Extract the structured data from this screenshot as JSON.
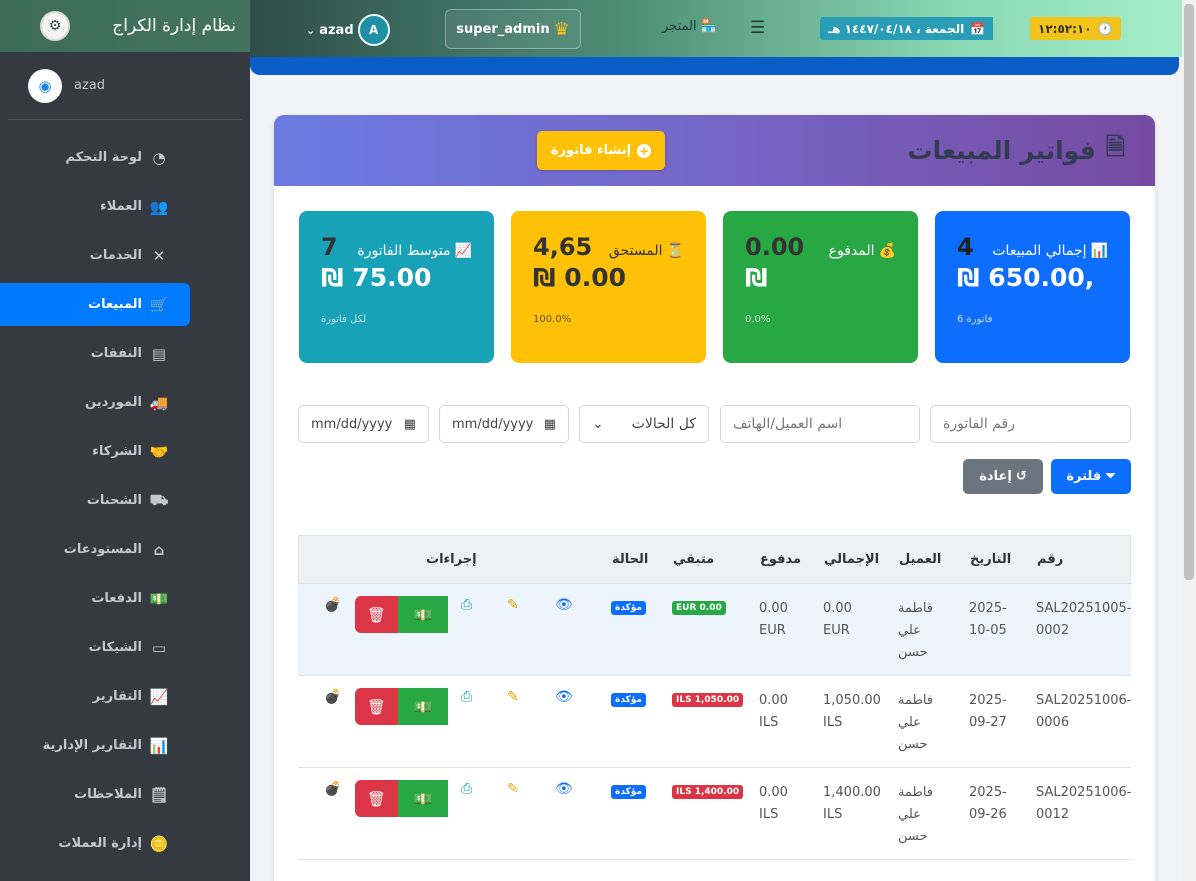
{
  "brand": {
    "title": "نظام إدارة الكراج"
  },
  "user_panel": {
    "name": "azad"
  },
  "sidebar": {
    "items": [
      {
        "label": "لوحة التحكم",
        "icon": "dashboard-icon"
      },
      {
        "label": "العملاء",
        "icon": "users-icon"
      },
      {
        "label": "الخدمات",
        "icon": "tools-icon"
      },
      {
        "label": "المبيعات",
        "icon": "cart-icon",
        "active": true
      },
      {
        "label": "النفقات",
        "icon": "receipt-icon"
      },
      {
        "label": "الموردين",
        "icon": "truck-icon"
      },
      {
        "label": "الشركاء",
        "icon": "handshake-icon"
      },
      {
        "label": "الشحنات",
        "icon": "shipping-icon"
      },
      {
        "label": "المستودعات",
        "icon": "warehouse-icon"
      },
      {
        "label": "الدفعات",
        "icon": "money-icon"
      },
      {
        "label": "الشيكات",
        "icon": "check-icon"
      },
      {
        "label": "التقارير",
        "icon": "chart-line-icon"
      },
      {
        "label": "التقارير الإدارية",
        "icon": "chart-bar-icon"
      },
      {
        "label": "الملاحظات",
        "icon": "note-icon"
      },
      {
        "label": "إدارة العملات",
        "icon": "coins-icon"
      }
    ]
  },
  "topbar": {
    "user": "azad",
    "avatar_letter": "A",
    "role": "super_admin",
    "store": "المتجر",
    "date": "الجمعة ، ١٤٤٧/٠٤/١٨ هـ",
    "time": "١٢:٥٢:١٠"
  },
  "header": {
    "title": "فواتير المبيعات",
    "create_button": "إنشاء فاتورة"
  },
  "stats": [
    {
      "number": "4",
      "label": "إجمالي المبيعات",
      "emoji": "📊",
      "value": "₪ 650.00,",
      "sub": "6 فاتورة"
    },
    {
      "number": "0.00",
      "label": "المدفوع",
      "emoji": "💰",
      "value": "₪",
      "sub": "0.0%"
    },
    {
      "number": "4,65",
      "label": "المستحق",
      "emoji": "⏳",
      "value": "₪ 0.00",
      "sub": "100.0%"
    },
    {
      "number": "7",
      "label": "متوسط الفاتورة",
      "emoji": "📈",
      "value": "₪ 75.00",
      "sub": "لكل فاتورة"
    }
  ],
  "filters": {
    "invoice_placeholder": "رقم الفاتورة",
    "customer_placeholder": "اسم العميل/الهاتف",
    "status_selected": "كل الحالات",
    "date_from": "mm/dd/yyyy",
    "date_to": "mm/dd/yyyy",
    "filter_button": "فلترة",
    "reset_button": "إعادة"
  },
  "table": {
    "headers": {
      "number": "رقم",
      "date": "التاريخ",
      "customer": "العميل",
      "total": "الإجمالي",
      "paid": "مدفوع",
      "remaining": "متبقي",
      "status": "الحالة",
      "actions": "إجراءات"
    },
    "rows": [
      {
        "number": "SAL20251005-0002",
        "date": "2025-10-05",
        "customer": "فاطمة علي حسن",
        "total": "0.00 EUR",
        "paid": "0.00 EUR",
        "remaining": "EUR 0.00",
        "remaining_color": "green",
        "status": "مؤكدة"
      },
      {
        "number": "SAL20251006-0006",
        "date": "2025-09-27",
        "customer": "فاطمة علي حسن",
        "total": "1,050.00 ILS",
        "paid": "0.00 ILS",
        "remaining": "ILS 1,050.00",
        "remaining_color": "red",
        "status": "مؤكدة"
      },
      {
        "number": "SAL20251006-0012",
        "date": "2025-09-26",
        "customer": "فاطمة علي حسن",
        "total": "1,400.00 ILS",
        "paid": "0.00 ILS",
        "remaining": "ILS 1,400.00",
        "remaining_color": "red",
        "status": "مؤكدة"
      }
    ]
  }
}
